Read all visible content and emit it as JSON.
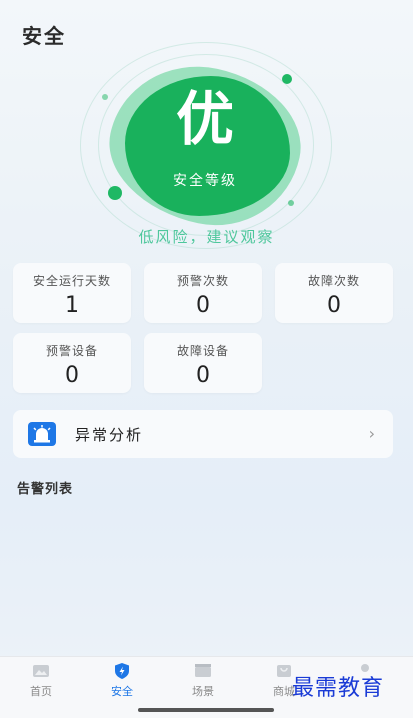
{
  "header": {
    "title": "安全"
  },
  "grade": {
    "value": "优",
    "label": "安全等级",
    "risk_text": "低风险，建议观察"
  },
  "stats": [
    {
      "label": "安全运行天数",
      "value": "1"
    },
    {
      "label": "预警次数",
      "value": "0"
    },
    {
      "label": "故障次数",
      "value": "0"
    },
    {
      "label": "预警设备",
      "value": "0"
    },
    {
      "label": "故障设备",
      "value": "0"
    }
  ],
  "analysis": {
    "label": "异常分析",
    "icon": "alarm-light-icon"
  },
  "alarm_list": {
    "title": "告警列表"
  },
  "tabbar": {
    "items": [
      {
        "label": "首页",
        "icon": "home-icon",
        "active": false
      },
      {
        "label": "安全",
        "icon": "shield-icon",
        "active": true
      },
      {
        "label": "场景",
        "icon": "scene-icon",
        "active": false
      },
      {
        "label": "商城",
        "icon": "mall-icon",
        "active": false
      },
      {
        "label": "",
        "icon": "profile-icon",
        "active": false
      }
    ]
  },
  "watermark": "最需教育",
  "colors": {
    "accent": "#1e77e6",
    "grade_green": "#19b15c",
    "risk_text": "#4ec79c"
  }
}
